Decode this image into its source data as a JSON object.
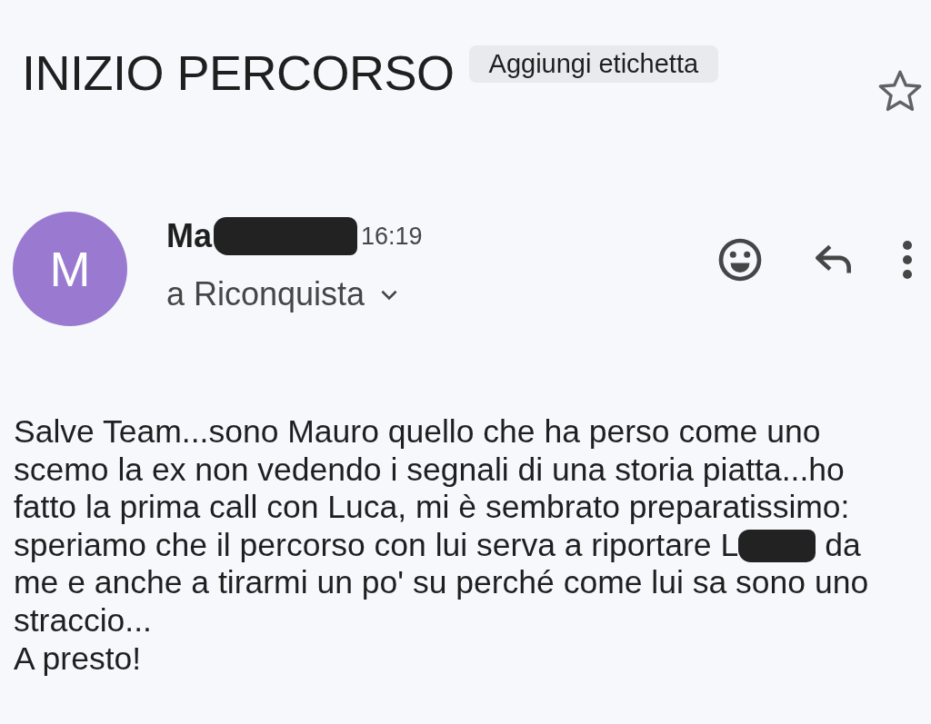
{
  "subject": "INIZIO PERCORSO",
  "label_chip": "Aggiungi etichetta",
  "starred": false,
  "sender": {
    "avatar_letter": "M",
    "name": "Ma",
    "redacted": true,
    "time": "16:19",
    "recipient": "a Riconquista"
  },
  "body": [
    {
      "text": "Salve Team...sono Mauro quello che ha perso come uno"
    },
    {
      "text": "scemo la ex non vedendo i segnali di una storia piatta...ho"
    },
    {
      "text": "fatto la prima call con Luca, mi è sembrato preparatissimo:"
    },
    {
      "text": "speriamo che il percorso con lui serva a riportare L",
      "redacted": true,
      "after": "da"
    },
    {
      "text": "me e anche a tirarmi un po' su perché come lui sa sono uno"
    },
    {
      "text": "straccio..."
    },
    {
      "text": "A presto!"
    }
  ]
}
